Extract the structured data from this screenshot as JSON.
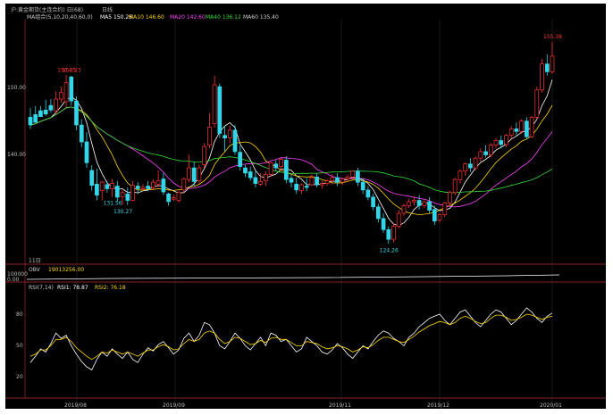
{
  "header": {
    "title": "沪:黄金期货(主连合约) 日(68)",
    "mode_label": "日线",
    "ma_group_label": "MA组合(5,10,20,40,60,0)",
    "ma_items": [
      {
        "label": "MA5 150.26",
        "color": "#ffffff"
      },
      {
        "label": "MA10 146.60",
        "color": "#ffd700"
      },
      {
        "label": "MA20 142.60",
        "color": "#ff44ff"
      },
      {
        "label": "MA40 136.12",
        "color": "#33dd33"
      },
      {
        "label": "MA60 135.40",
        "color": "#cccccc"
      }
    ]
  },
  "obv_panel": {
    "label": "OBV",
    "value_label": "19013256.00",
    "ticks": [
      "100000",
      "0.00"
    ]
  },
  "rsi_panel": {
    "label": "RSI(7,14)",
    "rsi1_label": "RSI1: 78.87",
    "rsi2_label": "RSI2: 76.18",
    "ticks": [
      "80",
      "50",
      "20"
    ]
  },
  "x_axis": {
    "ticks": [
      "2019/08",
      "2019/09",
      "2019/11",
      "2019/12",
      "2020/01"
    ]
  },
  "y_axis": {
    "ticks": [
      "150.00",
      "140.00"
    ]
  },
  "annotations": {
    "high1": "150.25",
    "high2": "150.23",
    "high3": "155.38",
    "low1": "130.27",
    "low2": "131.56",
    "low3": "124.26",
    "sub_label": "11日"
  },
  "colors": {
    "up": "#ff3333",
    "down": "#33d6e8",
    "ma5": "#ffffff",
    "ma10": "#ffd700",
    "ma20": "#ff44ff",
    "ma40": "#33dd33",
    "rsi1": "#ffffff",
    "rsi2": "#ffd700",
    "label_red": "#ff3333",
    "label_cyan": "#33d6e8"
  },
  "chart_data": {
    "type": "candlestick",
    "y_range": [
      122,
      158
    ],
    "candles": [
      [
        143.8,
        145.2,
        142.6,
        142.0
      ],
      [
        144.2,
        145.5,
        143.0,
        143.5
      ],
      [
        144.8,
        145.5,
        143.9,
        144.2
      ],
      [
        144.9,
        146.5,
        144.3,
        144.0
      ],
      [
        145.6,
        146.6,
        144.9,
        144.5
      ],
      [
        144.8,
        147.8,
        146.6,
        144.3
      ],
      [
        146.6,
        148.5,
        147.6,
        146.0
      ],
      [
        146.2,
        150.3,
        149.1,
        145.3
      ],
      [
        150.0,
        150.2,
        146.3,
        145.6
      ],
      [
        146.3,
        147.0,
        142.6,
        141.8
      ],
      [
        142.6,
        143.5,
        140.0,
        139.2
      ],
      [
        140.0,
        141.5,
        136.8,
        136.0
      ],
      [
        135.6,
        136.4,
        133.3,
        132.5
      ],
      [
        133.5,
        135.9,
        131.8,
        131.0
      ],
      [
        132.5,
        134.0,
        133.8,
        131.0
      ],
      [
        133.4,
        134.0,
        132.8,
        132.2
      ],
      [
        132.8,
        134.3,
        133.6,
        131.5
      ],
      [
        133.2,
        134.0,
        131.5,
        130.8
      ],
      [
        131.6,
        132.6,
        132.2,
        130.3
      ],
      [
        132.0,
        133.0,
        131.0,
        130.3
      ],
      [
        131.0,
        134.0,
        133.3,
        130.9
      ],
      [
        133.2,
        133.8,
        132.8,
        132.0
      ],
      [
        132.8,
        133.5,
        133.0,
        132.4
      ],
      [
        133.2,
        134.0,
        132.8,
        132.4
      ],
      [
        133.0,
        134.2,
        133.8,
        132.6
      ],
      [
        133.5,
        135.6,
        134.0,
        133.0
      ],
      [
        134.3,
        135.2,
        132.3,
        131.8
      ],
      [
        132.0,
        132.2,
        130.8,
        130.2
      ],
      [
        131.2,
        131.8,
        131.4,
        130.9
      ],
      [
        131.0,
        132.5,
        132.2,
        130.6
      ],
      [
        132.6,
        134.5,
        134.3,
        132.2
      ],
      [
        134.2,
        138.0,
        136.0,
        133.8
      ],
      [
        136.0,
        137.0,
        133.9,
        133.2
      ],
      [
        134.0,
        136.5,
        136.0,
        133.6
      ],
      [
        136.5,
        139.8,
        139.3,
        136.0
      ],
      [
        139.5,
        144.4,
        142.3,
        139.0
      ],
      [
        142.8,
        150.2,
        148.8,
        142.2
      ],
      [
        148.5,
        149.0,
        141.3,
        140.6
      ],
      [
        141.0,
        142.5,
        140.6,
        138.5
      ],
      [
        140.6,
        142.5,
        141.8,
        139.8
      ],
      [
        141.8,
        142.6,
        138.5,
        138.0
      ],
      [
        138.4,
        139.4,
        136.2,
        135.6
      ],
      [
        136.0,
        136.5,
        135.2,
        134.6
      ],
      [
        135.4,
        136.2,
        134.5,
        134.0
      ],
      [
        134.5,
        135.6,
        133.6,
        133.0
      ],
      [
        133.5,
        135.2,
        133.9,
        133.2
      ],
      [
        134.0,
        135.5,
        135.0,
        133.2
      ],
      [
        135.0,
        137.0,
        136.8,
        134.6
      ],
      [
        136.6,
        137.2,
        136.0,
        135.5
      ],
      [
        136.2,
        137.5,
        137.3,
        135.5
      ],
      [
        137.2,
        137.8,
        134.2,
        133.6
      ],
      [
        134.4,
        135.0,
        133.8,
        133.0
      ],
      [
        133.5,
        134.5,
        132.6,
        132.0
      ],
      [
        132.5,
        133.6,
        133.4,
        132.0
      ],
      [
        133.2,
        134.4,
        133.0,
        132.4
      ],
      [
        133.4,
        135.0,
        134.5,
        133.2
      ],
      [
        134.6,
        135.2,
        133.4,
        133.0
      ],
      [
        133.4,
        134.0,
        133.6,
        132.8
      ],
      [
        133.6,
        134.3,
        134.0,
        133.2
      ],
      [
        134.0,
        135.0,
        134.5,
        133.5
      ],
      [
        134.5,
        135.2,
        133.8,
        133.2
      ],
      [
        133.8,
        134.5,
        134.3,
        133.4
      ],
      [
        134.3,
        135.0,
        134.6,
        133.8
      ],
      [
        134.6,
        135.6,
        135.5,
        134.2
      ],
      [
        135.5,
        136.0,
        133.8,
        133.2
      ],
      [
        133.8,
        134.4,
        132.6,
        132.0
      ],
      [
        132.6,
        133.2,
        131.5,
        131.0
      ],
      [
        131.5,
        132.0,
        130.0,
        129.5
      ],
      [
        130.0,
        130.5,
        128.2,
        127.6
      ],
      [
        128.2,
        129.0,
        126.5,
        126.0
      ],
      [
        126.5,
        127.0,
        125.0,
        124.3
      ],
      [
        125.0,
        127.5,
        127.0,
        124.5
      ],
      [
        127.0,
        129.5,
        129.0,
        126.6
      ],
      [
        129.0,
        130.5,
        130.2,
        128.6
      ],
      [
        130.2,
        131.2,
        130.8,
        129.8
      ],
      [
        130.8,
        131.6,
        131.0,
        130.2
      ],
      [
        131.0,
        131.8,
        130.2,
        129.6
      ],
      [
        130.2,
        131.0,
        130.8,
        129.8
      ],
      [
        130.8,
        131.5,
        129.5,
        129.0
      ],
      [
        129.6,
        130.2,
        127.8,
        127.2
      ],
      [
        128.0,
        129.0,
        128.8,
        127.6
      ],
      [
        128.8,
        130.8,
        130.6,
        128.4
      ],
      [
        130.6,
        132.5,
        132.2,
        130.2
      ],
      [
        132.2,
        134.5,
        134.2,
        131.8
      ],
      [
        134.2,
        135.8,
        135.5,
        133.6
      ],
      [
        135.5,
        136.8,
        136.6,
        134.8
      ],
      [
        136.6,
        137.5,
        136.0,
        135.4
      ],
      [
        136.0,
        137.8,
        137.5,
        135.6
      ],
      [
        137.5,
        139.0,
        138.5,
        137.0
      ],
      [
        138.5,
        139.5,
        138.0,
        137.6
      ],
      [
        138.0,
        139.8,
        139.5,
        137.6
      ],
      [
        139.5,
        140.6,
        140.2,
        139.0
      ],
      [
        140.2,
        141.0,
        139.6,
        139.0
      ],
      [
        139.6,
        141.2,
        141.0,
        139.2
      ],
      [
        141.0,
        142.4,
        142.0,
        140.5
      ],
      [
        142.0,
        143.0,
        141.6,
        141.0
      ],
      [
        141.6,
        143.5,
        143.2,
        141.2
      ],
      [
        143.2,
        143.8,
        140.8,
        140.4
      ],
      [
        140.8,
        144.0,
        143.8,
        140.6
      ],
      [
        143.8,
        148.5,
        148.0,
        143.5
      ],
      [
        148.0,
        152.8,
        152.0,
        147.6
      ],
      [
        152.0,
        153.5,
        150.8,
        150.2
      ],
      [
        150.8,
        155.4,
        153.2,
        150.5
      ]
    ],
    "annotations": [
      {
        "label": "150.25",
        "value": 150.25,
        "type": "high"
      },
      {
        "label": "150.23",
        "value": 150.23,
        "type": "high"
      },
      {
        "label": "155.38",
        "value": 155.38,
        "type": "high"
      },
      {
        "label": "130.27",
        "value": 130.27,
        "type": "low"
      },
      {
        "label": "131.56",
        "value": 131.56,
        "type": "low"
      },
      {
        "label": "124.26",
        "value": 124.26,
        "type": "low"
      }
    ],
    "rsi": {
      "y_range": [
        0,
        100
      ],
      "rsi1": [
        32,
        38,
        45,
        42,
        50,
        60,
        55,
        58,
        48,
        40,
        33,
        28,
        25,
        35,
        42,
        38,
        45,
        40,
        36,
        42,
        35,
        32,
        40,
        46,
        43,
        49,
        52,
        46,
        40,
        44,
        55,
        60,
        52,
        58,
        70,
        68,
        60,
        48,
        45,
        52,
        60,
        55,
        48,
        44,
        50,
        56,
        48,
        60,
        58,
        52,
        54,
        48,
        42,
        45,
        56,
        52,
        48,
        42,
        40,
        44,
        50,
        46,
        40,
        36,
        42,
        48,
        45,
        52,
        58,
        62,
        60,
        55,
        52,
        48,
        56,
        60,
        66,
        70,
        74,
        76,
        78,
        72,
        68,
        74,
        80,
        82,
        76,
        70,
        66,
        72,
        78,
        82,
        80,
        74,
        68,
        72,
        78,
        84,
        80,
        74,
        70,
        76,
        79
      ],
      "rsi2": [
        38,
        40,
        44,
        44,
        48,
        54,
        54,
        56,
        52,
        46,
        42,
        38,
        35,
        38,
        42,
        41,
        44,
        42,
        40,
        42,
        40,
        38,
        41,
        44,
        44,
        47,
        49,
        47,
        44,
        45,
        50,
        54,
        52,
        54,
        60,
        62,
        60,
        54,
        50,
        52,
        56,
        55,
        52,
        49,
        50,
        53,
        51,
        55,
        56,
        54,
        54,
        51,
        48,
        48,
        52,
        51,
        50,
        47,
        45,
        46,
        48,
        47,
        45,
        42,
        44,
        47,
        46,
        49,
        53,
        56,
        56,
        54,
        52,
        51,
        54,
        57,
        61,
        64,
        67,
        69,
        71,
        70,
        68,
        70,
        74,
        76,
        74,
        71,
        69,
        70,
        74,
        77,
        77,
        75,
        72,
        73,
        75,
        78,
        77,
        75,
        73,
        75,
        76
      ]
    }
  }
}
